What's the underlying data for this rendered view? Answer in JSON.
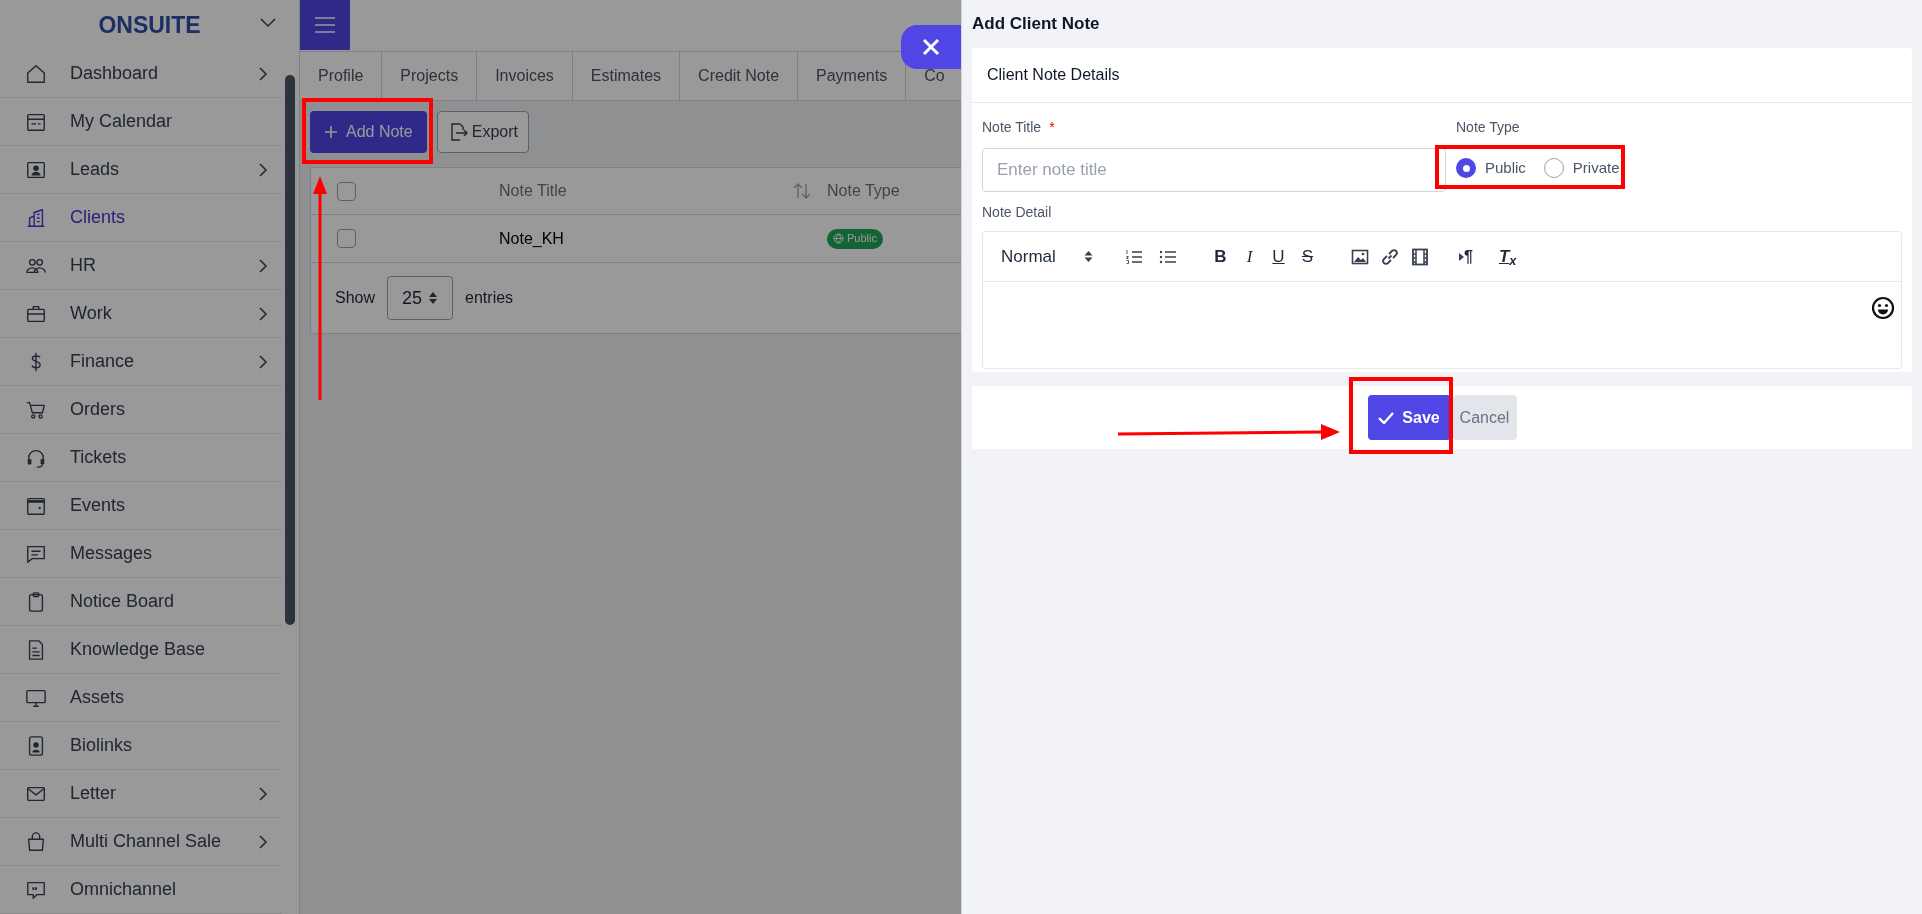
{
  "sidebar": {
    "brand": "ONSUITE",
    "items": [
      {
        "label": "Dashboard",
        "has_submenu": true,
        "selected": false
      },
      {
        "label": "My Calendar",
        "has_submenu": false,
        "selected": false
      },
      {
        "label": "Leads",
        "has_submenu": true,
        "selected": false
      },
      {
        "label": "Clients",
        "has_submenu": false,
        "selected": true
      },
      {
        "label": "HR",
        "has_submenu": true,
        "selected": false
      },
      {
        "label": "Work",
        "has_submenu": true,
        "selected": false
      },
      {
        "label": "Finance",
        "has_submenu": true,
        "selected": false
      },
      {
        "label": "Orders",
        "has_submenu": false,
        "selected": false
      },
      {
        "label": "Tickets",
        "has_submenu": false,
        "selected": false
      },
      {
        "label": "Events",
        "has_submenu": false,
        "selected": false
      },
      {
        "label": "Messages",
        "has_submenu": false,
        "selected": false
      },
      {
        "label": "Notice Board",
        "has_submenu": false,
        "selected": false
      },
      {
        "label": "Knowledge Base",
        "has_submenu": false,
        "selected": false
      },
      {
        "label": "Assets",
        "has_submenu": false,
        "selected": false
      },
      {
        "label": "Biolinks",
        "has_submenu": false,
        "selected": false
      },
      {
        "label": "Letter",
        "has_submenu": true,
        "selected": false
      },
      {
        "label": "Multi Channel Sale",
        "has_submenu": true,
        "selected": false
      },
      {
        "label": "Omnichannel",
        "has_submenu": false,
        "selected": false
      }
    ]
  },
  "tabs": [
    "Profile",
    "Projects",
    "Invoices",
    "Estimates",
    "Credit Note",
    "Payments",
    "Co"
  ],
  "toolbar": {
    "add_button": "Add Note",
    "export_button": "Export"
  },
  "table": {
    "select_all_checked": false,
    "columns": [
      "Note Title",
      "Note Type"
    ],
    "rows": [
      {
        "checked": false,
        "note_title": "Note_KH",
        "note_type": "Public"
      }
    ],
    "show_label": "Show",
    "page_size": "25",
    "entries_label": "entries"
  },
  "panel": {
    "title": "Add Client Note",
    "card_title": "Client Note Details",
    "note_title": {
      "label": "Note Title",
      "required_mark": "*",
      "placeholder": "Enter note title"
    },
    "note_type": {
      "label": "Note Type",
      "options": [
        {
          "label": "Public",
          "selected": true
        },
        {
          "label": "Private",
          "selected": false
        }
      ]
    },
    "note_detail": {
      "label": "Note Detail",
      "format_select": "Normal",
      "format_buttons": [
        "B",
        "I",
        "U",
        "S"
      ],
      "direction_button": "¶",
      "clean_button": "T$_{x}$"
    },
    "save_button": "Save",
    "cancel_button": "Cancel"
  }
}
